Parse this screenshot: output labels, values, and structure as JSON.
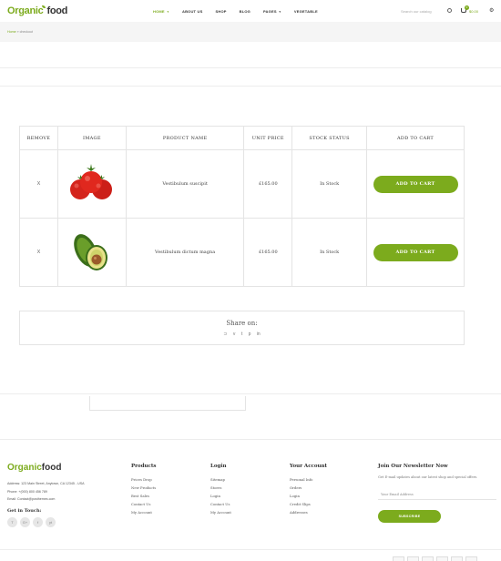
{
  "header": {
    "logo_main": "Organic",
    "logo_suffix": "food",
    "nav": [
      {
        "label": "HOME",
        "active": true,
        "has_caret": true
      },
      {
        "label": "ABOUT US"
      },
      {
        "label": "SHOP"
      },
      {
        "label": "BLOG"
      },
      {
        "label": "PAGES",
        "has_caret": true
      },
      {
        "label": "VEGETABLE"
      }
    ],
    "search_placeholder": "Search our catalog",
    "cart_count": "0",
    "cart_total": "$0.00"
  },
  "breadcrumb": {
    "home": "Home",
    "sep": "»",
    "current": "checkout"
  },
  "table": {
    "headers": {
      "remove": "REMOVE",
      "image": "IMAGE",
      "name": "PRODUCT NAME",
      "price": "UNIT PRICE",
      "stock": "STOCK STATUS",
      "cart": "ADD TO CART"
    },
    "rows": [
      {
        "remove": "X",
        "name": "Vestibulum suscipit",
        "price": "£165.00",
        "stock": "In Stock",
        "button": "ADD TO CART",
        "image": "tomatoes"
      },
      {
        "remove": "X",
        "name": "Vestibulum dictum magna",
        "price": "£165.00",
        "stock": "In Stock",
        "button": "ADD TO CART",
        "image": "avocado"
      }
    ]
  },
  "share": {
    "title": "Share on:",
    "icons": [
      "rss-icon",
      "vimeo-icon",
      "tumblr-icon",
      "pinterest-icon",
      "linkedin-icon"
    ]
  },
  "footer": {
    "logo_main": "Organic",
    "logo_suffix": "food",
    "address": "Address: 123 Main Street, Anytown, CA 12345 - USA",
    "phone": "Phone: +(000) 800 456 789",
    "email": "Email: Contact@posthemes.com",
    "get_in_touch": "Get in Touch:",
    "socials": [
      "T",
      "G+",
      "f",
      "yt"
    ],
    "columns": [
      {
        "title": "Products",
        "links": [
          "Prices Drop",
          "New Products",
          "Best Sales",
          "Contact Us",
          "My Account"
        ]
      },
      {
        "title": "Login",
        "links": [
          "Sitemap",
          "Stores",
          "Login",
          "Contact Us",
          "My Account"
        ]
      },
      {
        "title": "Your Account",
        "links": [
          "Personal Info",
          "Orders",
          "Login",
          "Credit Slips",
          "Addresses"
        ]
      }
    ],
    "newsletter": {
      "title": "Join Our Newsletter Now",
      "text": "Get E-mail updates about our latest shop and special offers.",
      "placeholder": "Your Email Address",
      "button": "SUBSCRIBE"
    }
  },
  "colors": {
    "accent": "#7cab1d",
    "border": "#e4e4e4",
    "crumb_bg": "#f5f5f5"
  }
}
